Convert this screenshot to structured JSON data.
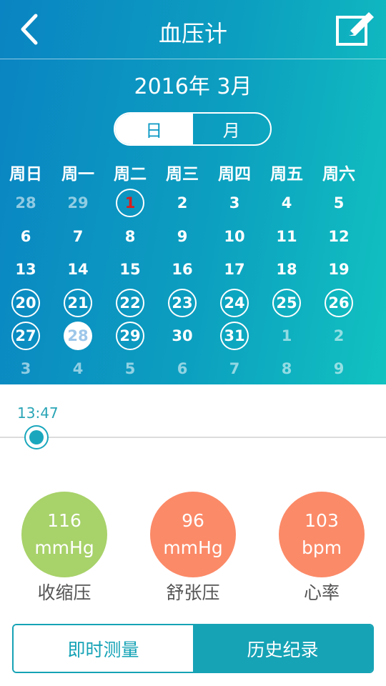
{
  "header": {
    "title": "血压计",
    "back_icon": "chevron-left-icon",
    "edit_icon": "edit-note-icon"
  },
  "calendar": {
    "month_label": "2016年 3月",
    "view_toggle": {
      "day": "日",
      "month": "月",
      "selected": "day"
    },
    "weekdays": [
      "周日",
      "周一",
      "周二",
      "周三",
      "周四",
      "周五",
      "周六"
    ],
    "weeks": [
      [
        {
          "d": "28",
          "dim": true
        },
        {
          "d": "29",
          "dim": true
        },
        {
          "d": "1",
          "today": true,
          "ring": true
        },
        {
          "d": "2"
        },
        {
          "d": "3"
        },
        {
          "d": "4"
        },
        {
          "d": "5"
        }
      ],
      [
        {
          "d": "6"
        },
        {
          "d": "7"
        },
        {
          "d": "8"
        },
        {
          "d": "9"
        },
        {
          "d": "10"
        },
        {
          "d": "11"
        },
        {
          "d": "12"
        }
      ],
      [
        {
          "d": "13"
        },
        {
          "d": "14"
        },
        {
          "d": "15"
        },
        {
          "d": "16"
        },
        {
          "d": "17"
        },
        {
          "d": "18"
        },
        {
          "d": "19"
        }
      ],
      [
        {
          "d": "20",
          "ring": true
        },
        {
          "d": "21",
          "ring": true
        },
        {
          "d": "22",
          "ring": true
        },
        {
          "d": "23",
          "ring": true
        },
        {
          "d": "24",
          "ring": true
        },
        {
          "d": "25",
          "ring": true
        },
        {
          "d": "26",
          "ring": true
        }
      ],
      [
        {
          "d": "27",
          "ring": true
        },
        {
          "d": "28",
          "selected": true
        },
        {
          "d": "29",
          "ring": true
        },
        {
          "d": "30"
        },
        {
          "d": "31",
          "ring": true
        },
        {
          "d": "1",
          "dim": true
        },
        {
          "d": "2",
          "dim": true
        }
      ],
      [
        {
          "d": "3",
          "dim": true
        },
        {
          "d": "4",
          "dim": true
        },
        {
          "d": "5",
          "dim": true
        },
        {
          "d": "6",
          "dim": true
        },
        {
          "d": "7",
          "dim": true
        },
        {
          "d": "8",
          "dim": true
        },
        {
          "d": "9",
          "dim": true
        }
      ]
    ]
  },
  "timeline": {
    "time": "13:47"
  },
  "metrics": [
    {
      "value": "116",
      "unit": "mmHg",
      "label": "收缩压",
      "color": "#a8d26a"
    },
    {
      "value": "96",
      "unit": "mmHg",
      "label": "舒张压",
      "color": "#fb8a68"
    },
    {
      "value": "103",
      "unit": "bpm",
      "label": "心率",
      "color": "#fb8a68"
    }
  ],
  "actions": {
    "measure_now": "即时测量",
    "history": "历史纪录"
  },
  "colors": {
    "accent": "#16a3b6",
    "header_gradient_start": "#0a84c2",
    "header_gradient_end": "#11c2c0",
    "today": "#d81e1e"
  }
}
